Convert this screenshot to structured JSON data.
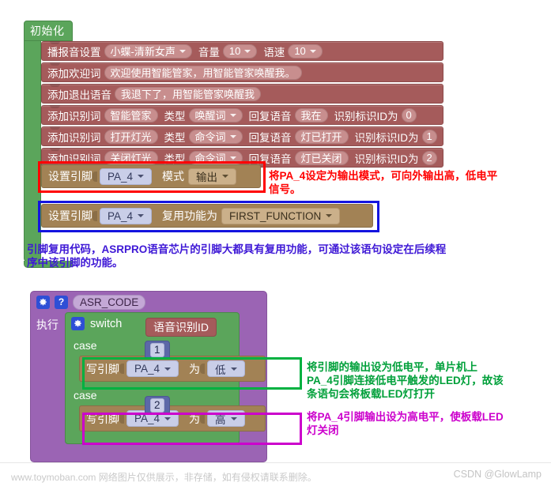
{
  "init": {
    "hat_label": "初始化",
    "blocks": [
      {
        "name": "voice-setting",
        "label": "播报音设置",
        "voice": "小蝶-清新女声",
        "volume_label": "音量",
        "volume": "10",
        "speed_label": "语速",
        "speed": "10"
      },
      {
        "name": "welcome-word",
        "label": "添加欢迎词",
        "text": "欢迎使用智能管家，用智能管家唤醒我。"
      },
      {
        "name": "exit-voice",
        "label": "添加退出语音",
        "text": "我退下了，用智能管家唤醒我"
      },
      {
        "name": "recognize-word-0",
        "label": "添加识别词",
        "word": "智能管家",
        "type_label": "类型",
        "type": "唤醒词",
        "reply_label": "回复语音",
        "reply": "我在",
        "id_label": "识别标识ID为",
        "id": "0"
      },
      {
        "name": "recognize-word-1",
        "label": "添加识别词",
        "word": "打开灯光",
        "type_label": "类型",
        "type": "命令词",
        "reply_label": "回复语音",
        "reply": "灯已打开",
        "id_label": "识别标识ID为",
        "id": "1"
      },
      {
        "name": "recognize-word-2",
        "label": "添加识别词",
        "word": "关闭灯光",
        "type_label": "类型",
        "type": "命令词",
        "reply_label": "回复语音",
        "reply": "灯已关闭",
        "id_label": "识别标识ID为",
        "id": "2"
      }
    ],
    "pin_mode_block": {
      "label": "设置引脚",
      "pin": "PA_4",
      "mode_label": "模式",
      "mode": "输出"
    },
    "pin_function_block": {
      "label": "设置引脚",
      "pin": "PA_4",
      "function_label": "复用功能为",
      "function": "FIRST_FUNCTION"
    }
  },
  "annotations": {
    "red_note": "将PA_4设定为输出模式，可向外输出高，低电平\n信号。",
    "purple_note": "引脚复用代码，ASRPRO语音芯片的引脚大都具有复用功能，可通过该语句设定在后续程\n序中该引脚的功能。",
    "green_note": "将引脚的输出设为低电平，单片机上\nPA_4引脚连接低电平触发的LED灯，故该\n条语句会将板载LED灯打开",
    "magenta_note": "将PA_4引脚输出设为高电平，使板载LED\n灯关闭"
  },
  "asr": {
    "gear_icon": "gear-icon",
    "help_icon": "question-mark-icon",
    "name": "ASR_CODE",
    "do_label": "执行",
    "switch": {
      "gear_icon": "gear-icon",
      "label": "switch",
      "value": "语音识别ID",
      "cases": [
        {
          "case_label": "case",
          "case_value": "1",
          "statement": {
            "label": "写引脚",
            "pin": "PA_4",
            "as_label": "为",
            "level": "低"
          }
        },
        {
          "case_label": "case",
          "case_value": "2",
          "statement": {
            "label": "写引脚",
            "pin": "PA_4",
            "as_label": "为",
            "level": "高"
          }
        }
      ]
    }
  },
  "colors": {
    "green_block": "#5BA55B",
    "voice_block": "#A55B5B",
    "pin_block": "#A28255",
    "purple_block": "#9B64B4",
    "num_block": "#5C68A8",
    "highlight_red": "#FF0000",
    "highlight_blue": "#1414DF",
    "highlight_green": "#00B140",
    "highlight_magenta": "#CC00CC"
  },
  "footer": {
    "left_text": "www.toymoban.com 网络图片仅供展示，非存储，如有侵权请联系删除。",
    "right_text": "CSDN @GlowLamp"
  }
}
